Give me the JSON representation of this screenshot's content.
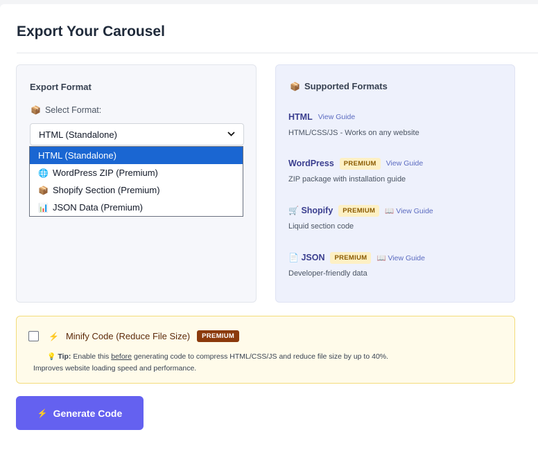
{
  "page": {
    "title": "Export Your Carousel"
  },
  "export_format": {
    "title": "Export Format",
    "select_label": "Select Format:",
    "select_label_icon": "📦",
    "selected_value": "HTML (Standalone)",
    "options": [
      {
        "icon": "",
        "label": "HTML (Standalone)",
        "selected": true
      },
      {
        "icon": "🌐",
        "label": "WordPress ZIP (Premium)",
        "selected": false
      },
      {
        "icon": "📦",
        "label": "Shopify Section (Premium)",
        "selected": false
      },
      {
        "icon": "📊",
        "label": "JSON Data (Premium)",
        "selected": false
      }
    ]
  },
  "supported": {
    "title": "Supported Formats",
    "title_icon": "📦",
    "formats": [
      {
        "icon": "",
        "name": "HTML",
        "badge": "",
        "guide_icon": "",
        "guide": "View Guide",
        "desc": "HTML/CSS/JS - Works on any website"
      },
      {
        "icon": "",
        "name": "WordPress",
        "badge": "PREMIUM",
        "guide_icon": "",
        "guide": "View Guide",
        "desc": "ZIP package with installation guide"
      },
      {
        "icon": "🛒",
        "name": "Shopify",
        "badge": "PREMIUM",
        "guide_icon": "📖",
        "guide": "View Guide",
        "desc": "Liquid section code"
      },
      {
        "icon": "📄",
        "name": "JSON",
        "badge": "PREMIUM",
        "guide_icon": "📖",
        "guide": "View Guide",
        "desc": "Developer-friendly data"
      }
    ]
  },
  "minify": {
    "label": "Minify Code (Reduce File Size)",
    "icon": "⚡",
    "badge": "PREMIUM",
    "checked": false,
    "tip_icon": "💡",
    "tip_label": "Tip:",
    "tip_pre": "Enable this",
    "tip_underlined": "before",
    "tip_post": "generating code to compress HTML/CSS/JS and reduce file size by up to 40%.",
    "tip_line2": "Improves website loading speed and performance."
  },
  "generate": {
    "label": "Generate Code",
    "icon": "⚡"
  },
  "colors": {
    "accent": "#6461f0",
    "selected_option": "#1a66d2",
    "premium_badge": "#fdf0c4",
    "premium_dark": "#8b3a0c"
  }
}
